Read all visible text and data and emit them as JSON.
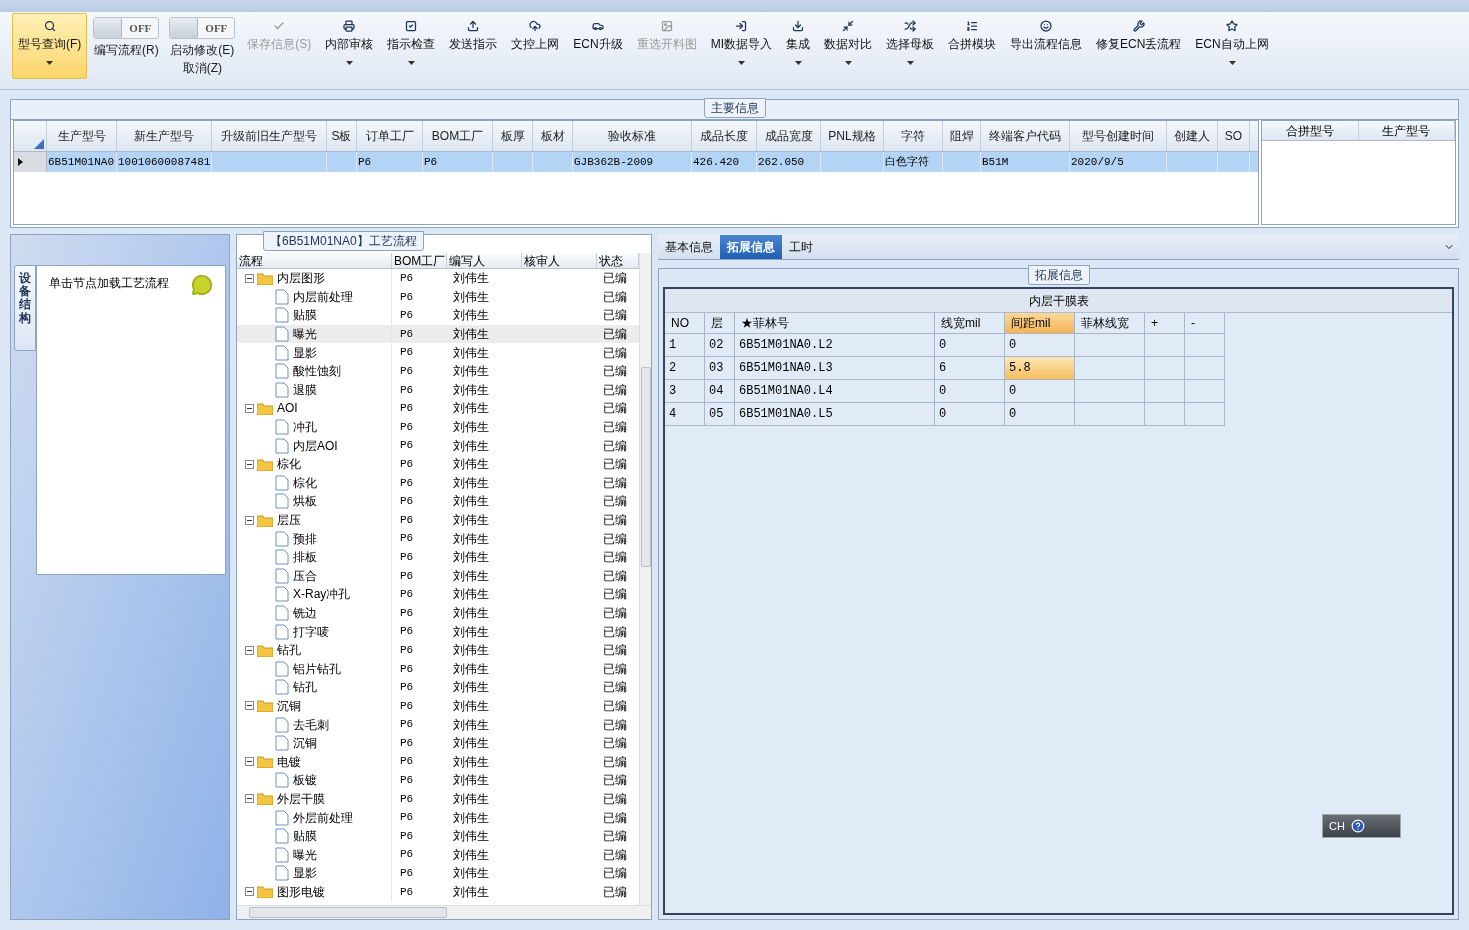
{
  "toolbar": [
    {
      "kind": "button",
      "label": "型号查询(F)",
      "selected": true,
      "disabled": false,
      "dropdown": true
    },
    {
      "kind": "toggle",
      "label": "编写流程(R)",
      "switch_text": "OFF",
      "on": false
    },
    {
      "kind": "toggle",
      "label": "启动修改(E)",
      "switch_text": "OFF",
      "on": false,
      "sub_label": "取消(Z)"
    },
    {
      "kind": "button",
      "label": "保存信息(S)",
      "selected": false,
      "disabled": true,
      "dropdown": false
    },
    {
      "kind": "button",
      "label": "内部审核",
      "selected": false,
      "disabled": false,
      "dropdown": true
    },
    {
      "kind": "button",
      "label": "指示检查",
      "selected": false,
      "disabled": false,
      "dropdown": true
    },
    {
      "kind": "button",
      "label": "发送指示",
      "selected": false,
      "disabled": false,
      "dropdown": false
    },
    {
      "kind": "button",
      "label": "文控上网",
      "selected": false,
      "disabled": false,
      "dropdown": false
    },
    {
      "kind": "button",
      "label": "ECN升级",
      "selected": false,
      "disabled": false,
      "dropdown": false
    },
    {
      "kind": "button",
      "label": "重选开料图",
      "selected": false,
      "disabled": true,
      "dropdown": false
    },
    {
      "kind": "button",
      "label": "MI数据导入",
      "selected": false,
      "disabled": false,
      "dropdown": true
    },
    {
      "kind": "button",
      "label": "集成",
      "selected": false,
      "disabled": false,
      "dropdown": true
    },
    {
      "kind": "button",
      "label": "数据对比",
      "selected": false,
      "disabled": false,
      "dropdown": true
    },
    {
      "kind": "button",
      "label": "选择母板",
      "selected": false,
      "disabled": false,
      "dropdown": true
    },
    {
      "kind": "button",
      "label": "合拼模块",
      "selected": false,
      "disabled": false,
      "dropdown": false
    },
    {
      "kind": "button",
      "label": "导出流程信息",
      "selected": false,
      "disabled": false,
      "dropdown": false
    },
    {
      "kind": "button",
      "label": "修复ECN丢流程",
      "selected": false,
      "disabled": false,
      "dropdown": false
    },
    {
      "kind": "button",
      "label": "ECN自动上网",
      "selected": false,
      "disabled": false,
      "dropdown": true
    }
  ],
  "main_info": {
    "title": "主要信息",
    "columns": [
      "生产型号",
      "新生产型号",
      "升级前旧生产型号",
      "S板",
      "订单工厂",
      "BOM工厂",
      "板厚",
      "板材",
      "验收标准",
      "成品长度",
      "成品宽度",
      "PNL规格",
      "字符",
      "阻焊",
      "终端客户代码",
      "型号创建时间",
      "创建人",
      "SO"
    ],
    "rows": [
      {
        "selected": true,
        "cells": [
          "6B51M01NA0",
          "10010600087481",
          "",
          "",
          "P6",
          "P6",
          "",
          "",
          "GJB362B-2009",
          "426.420",
          "262.050",
          "",
          "白色字符",
          "",
          "B51M",
          "2020/9/5",
          "",
          ""
        ]
      }
    ],
    "side_columns": [
      "合拼型号",
      "生产型号"
    ]
  },
  "left_panel": {
    "vertical_tab": "设备结构",
    "hint": "单击节点加载工艺流程"
  },
  "process": {
    "title": "【6B51M01NA0】工艺流程",
    "columns": [
      "流程",
      "BOM工厂",
      "编写人",
      "核审人",
      "状态"
    ],
    "tree": [
      {
        "kind": "folder",
        "name": "内层图形",
        "bom": "P6",
        "writer": "刘伟生",
        "status": "已编",
        "expanded": true,
        "selected": false,
        "children": [
          {
            "kind": "step",
            "name": "内层前处理",
            "bom": "P6",
            "writer": "刘伟生",
            "status": "已编",
            "selected": false
          },
          {
            "kind": "step",
            "name": "贴膜",
            "bom": "P6",
            "writer": "刘伟生",
            "status": "已编",
            "selected": false
          },
          {
            "kind": "step",
            "name": "曝光",
            "bom": "P6",
            "writer": "刘伟生",
            "status": "已编",
            "selected": true
          },
          {
            "kind": "step",
            "name": "显影",
            "bom": "P6",
            "writer": "刘伟生",
            "status": "已编",
            "selected": false
          },
          {
            "kind": "step",
            "name": "酸性蚀刻",
            "bom": "P6",
            "writer": "刘伟生",
            "status": "已编",
            "selected": false
          },
          {
            "kind": "step",
            "name": "退膜",
            "bom": "P6",
            "writer": "刘伟生",
            "status": "已编",
            "selected": false
          }
        ]
      },
      {
        "kind": "folder",
        "name": "AOI",
        "bom": "P6",
        "writer": "刘伟生",
        "status": "已编",
        "expanded": true,
        "selected": false,
        "children": [
          {
            "kind": "step",
            "name": "冲孔",
            "bom": "P6",
            "writer": "刘伟生",
            "status": "已编",
            "selected": false
          },
          {
            "kind": "step",
            "name": "内层AOI",
            "bom": "P6",
            "writer": "刘伟生",
            "status": "已编",
            "selected": false
          }
        ]
      },
      {
        "kind": "folder",
        "name": "棕化",
        "bom": "P6",
        "writer": "刘伟生",
        "status": "已编",
        "expanded": true,
        "selected": false,
        "children": [
          {
            "kind": "step",
            "name": "棕化",
            "bom": "P6",
            "writer": "刘伟生",
            "status": "已编",
            "selected": false
          },
          {
            "kind": "step",
            "name": "烘板",
            "bom": "P6",
            "writer": "刘伟生",
            "status": "已编",
            "selected": false
          }
        ]
      },
      {
        "kind": "folder",
        "name": "层压",
        "bom": "P6",
        "writer": "刘伟生",
        "status": "已编",
        "expanded": true,
        "selected": false,
        "children": [
          {
            "kind": "step",
            "name": "预排",
            "bom": "P6",
            "writer": "刘伟生",
            "status": "已编",
            "selected": false
          },
          {
            "kind": "step",
            "name": "排板",
            "bom": "P6",
            "writer": "刘伟生",
            "status": "已编",
            "selected": false
          },
          {
            "kind": "step",
            "name": "压合",
            "bom": "P6",
            "writer": "刘伟生",
            "status": "已编",
            "selected": false
          },
          {
            "kind": "step",
            "name": "X-Ray冲孔",
            "bom": "P6",
            "writer": "刘伟生",
            "status": "已编",
            "selected": false
          },
          {
            "kind": "step",
            "name": "铣边",
            "bom": "P6",
            "writer": "刘伟生",
            "status": "已编",
            "selected": false
          },
          {
            "kind": "step",
            "name": "打字唛",
            "bom": "P6",
            "writer": "刘伟生",
            "status": "已编",
            "selected": false
          }
        ]
      },
      {
        "kind": "folder",
        "name": "钻孔",
        "bom": "P6",
        "writer": "刘伟生",
        "status": "已编",
        "expanded": true,
        "selected": false,
        "children": [
          {
            "kind": "step",
            "name": "铝片钻孔",
            "bom": "P6",
            "writer": "刘伟生",
            "status": "已编",
            "selected": false
          },
          {
            "kind": "step",
            "name": "钻孔",
            "bom": "P6",
            "writer": "刘伟生",
            "status": "已编",
            "selected": false
          }
        ]
      },
      {
        "kind": "folder",
        "name": "沉铜",
        "bom": "P6",
        "writer": "刘伟生",
        "status": "已编",
        "expanded": true,
        "selected": false,
        "children": [
          {
            "kind": "step",
            "name": "去毛刺",
            "bom": "P6",
            "writer": "刘伟生",
            "status": "已编",
            "selected": false
          },
          {
            "kind": "step",
            "name": "沉铜",
            "bom": "P6",
            "writer": "刘伟生",
            "status": "已编",
            "selected": false
          }
        ]
      },
      {
        "kind": "folder",
        "name": "电镀",
        "bom": "P6",
        "writer": "刘伟生",
        "status": "已编",
        "expanded": true,
        "selected": false,
        "children": [
          {
            "kind": "step",
            "name": "板镀",
            "bom": "P6",
            "writer": "刘伟生",
            "status": "已编",
            "selected": false
          }
        ]
      },
      {
        "kind": "folder",
        "name": "外层干膜",
        "bom": "P6",
        "writer": "刘伟生",
        "status": "已编",
        "expanded": true,
        "selected": false,
        "children": [
          {
            "kind": "step",
            "name": "外层前处理",
            "bom": "P6",
            "writer": "刘伟生",
            "status": "已编",
            "selected": false
          },
          {
            "kind": "step",
            "name": "贴膜",
            "bom": "P6",
            "writer": "刘伟生",
            "status": "已编",
            "selected": false
          },
          {
            "kind": "step",
            "name": "曝光",
            "bom": "P6",
            "writer": "刘伟生",
            "status": "已编",
            "selected": false
          },
          {
            "kind": "step",
            "name": "显影",
            "bom": "P6",
            "writer": "刘伟生",
            "status": "已编",
            "selected": false
          }
        ]
      },
      {
        "kind": "folder",
        "name": "图形电镀",
        "bom": "P6",
        "writer": "刘伟生",
        "status": "已编",
        "expanded": true,
        "selected": false
      }
    ]
  },
  "detail": {
    "tabs": [
      {
        "label": "基本信息",
        "selected": false
      },
      {
        "label": "拓展信息",
        "selected": true
      },
      {
        "label": "工时",
        "selected": false
      }
    ],
    "group_title": "拓展信息",
    "table_title": "内层干膜表",
    "columns": [
      {
        "label": "NO",
        "highlighted": false
      },
      {
        "label": "层",
        "highlighted": false
      },
      {
        "label": "★菲林号",
        "highlighted": false
      },
      {
        "label": "线宽mil",
        "highlighted": false
      },
      {
        "label": "间距mil",
        "highlighted": true
      },
      {
        "label": "菲林线宽",
        "highlighted": false
      },
      {
        "label": "+",
        "highlighted": false
      },
      {
        "label": "-",
        "highlighted": false
      }
    ],
    "rows": [
      {
        "cells": [
          {
            "text": "1",
            "selected": false
          },
          {
            "text": "02",
            "selected": false
          },
          {
            "text": "6B51M01NA0.L2",
            "selected": false
          },
          {
            "text": "0",
            "selected": false
          },
          {
            "text": "0",
            "selected": false
          }
        ]
      },
      {
        "cells": [
          {
            "text": "2",
            "selected": false
          },
          {
            "text": "03",
            "selected": false
          },
          {
            "text": "6B51M01NA0.L3",
            "selected": false
          },
          {
            "text": "6",
            "selected": false
          },
          {
            "text": "5.8",
            "selected": true
          }
        ]
      },
      {
        "cells": [
          {
            "text": "3",
            "selected": false
          },
          {
            "text": "04",
            "selected": false
          },
          {
            "text": "6B51M01NA0.L4",
            "selected": false
          },
          {
            "text": "0",
            "selected": false
          },
          {
            "text": "0",
            "selected": false
          }
        ]
      },
      {
        "cells": [
          {
            "text": "4",
            "selected": false
          },
          {
            "text": "05",
            "selected": false
          },
          {
            "text": "6B51M01NA0.L5",
            "selected": false
          },
          {
            "text": "0",
            "selected": false
          },
          {
            "text": "0",
            "selected": false
          }
        ]
      }
    ]
  },
  "language_bar": {
    "text": "CH"
  }
}
